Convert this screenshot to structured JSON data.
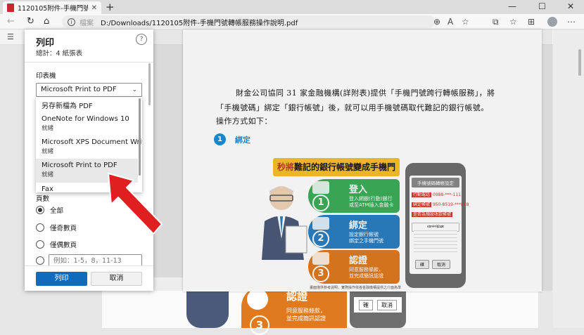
{
  "browser": {
    "tab_title": "1120105附件-手機門號轉帳服務",
    "close_tab": "✕",
    "new_tab": "+",
    "window_controls": [
      "—",
      "☐",
      "✕"
    ],
    "nav": {
      "back": "←",
      "reload": "↻",
      "home": "⌂"
    },
    "address": {
      "label": "檔案",
      "path": "D:/Downloads/1120105附件-手機門號轉帳服務操作說明.pdf"
    },
    "toolbar_icons": [
      "⊕",
      "A",
      "☆",
      "⧉",
      "☆",
      "⊞",
      "⋯"
    ]
  },
  "dialog": {
    "title": "列印",
    "subtitle": "總計：4 紙張表",
    "help": "?",
    "printer_label": "印表機",
    "printer_selected": "Microsoft Print to PDF",
    "printer_options": [
      {
        "name": "另存新檔為 PDF",
        "status": ""
      },
      {
        "name": "OneNote for Windows 10",
        "status": "就緒"
      },
      {
        "name": "Microsoft XPS Document Writer",
        "status": "就緒"
      },
      {
        "name": "Microsoft Print to PDF",
        "status": "就緒"
      },
      {
        "name": "Fax",
        "status": ""
      }
    ],
    "pages_label": "頁數",
    "page_options": [
      "全部",
      "僅奇數頁",
      "僅偶數頁"
    ],
    "custom_placeholder": "例如：1-5，8，11-13",
    "print_button": "列印",
    "cancel_button": "取消"
  },
  "preview": {
    "paragraph_1": "財金公司協同 31 家金融機構(詳附表)提供「手機門號跨行轉帳服務」，將",
    "paragraph_2": "「手機號碼」綁定「銀行帳號」後，就可以用手機號碼取代難記的銀行帳號。",
    "paragraph_3": "操作方式如下：",
    "step_number": "1",
    "step_title": "綁定",
    "banner": {
      "highlight": "秒將",
      "rest": "難記的銀行帳號變成手機門號"
    },
    "cards": [
      {
        "num": "1",
        "title": "登入",
        "sub": "登入網銀(行動)銀行\n或至ATM插入金融卡",
        "color": "#3bae5a"
      },
      {
        "num": "2",
        "title": "綁定",
        "sub": "設定銀行帳號\n綁定之手機門號",
        "color": "#2b7fc2"
      },
      {
        "num": "3",
        "title": "認證",
        "sub": "同意服務條款，\n並完成簡訊認證",
        "color": "#e07a1f"
      }
    ],
    "phone": {
      "header": "手機號碼轉帳設定",
      "row1_label": "行動電話",
      "row1_value": "0988-***-111",
      "row2_label": "綁定帳號",
      "row2_value": "950-8519-***888",
      "row3": "是否為預設收款帳號",
      "terms": "綁定服務",
      "confirm": "確",
      "cancel": "取消"
    },
    "footnote": "畫面僅供參考說明，實際操作依各金融機構提供之介面為準"
  },
  "page_behind": {
    "card_title": "認證",
    "card_num": "3",
    "card_sub": "同意服務條款，\n並完成簡訊認證",
    "phone_confirm": "確",
    "phone_cancel": "取消"
  }
}
